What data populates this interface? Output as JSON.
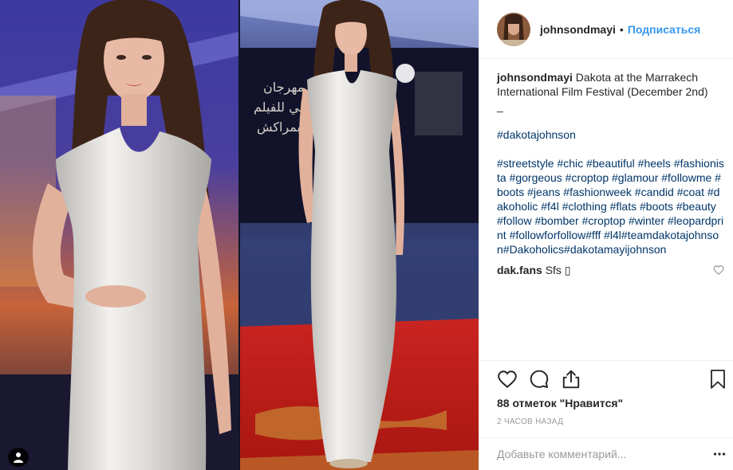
{
  "post": {
    "username": "johnsondmayi",
    "header_separator": "•",
    "follow_label": "Подписаться",
    "caption": {
      "username": "johnsondmayi",
      "text": "Dakota at the Marrakech International Film Festival (December 2nd)",
      "dash": "_",
      "tag_line": "#dakotajohnson",
      "hashtags": "#streetstyle #chic #beautiful #heels #fashionista #gorgeous #croptop #glamour #followme #boots #jeans #fashionweek #candid #coat #dakoholic #f4l #clothing #flats #boots #beauty #follow #bomber #croptop #winter #leopardprint #followforfollow#fff #l4l#teamdakotajohnson#Dakoholics#dakotamayijohnson"
    },
    "comments": [
      {
        "username": "dak.fans",
        "text": "Sfs ▯"
      }
    ],
    "likes": "88 отметок \"Нравится\"",
    "time": "2 часов назад",
    "add_comment_placeholder": "Добавьте комментарий..."
  },
  "icons": {
    "heart": "heart-icon",
    "comment": "comment-icon",
    "share": "share-icon",
    "bookmark": "bookmark-icon",
    "more": "more-icon",
    "user_tag": "user-tag-icon"
  },
  "colors": {
    "link_blue": "#3897f0",
    "hashtag_blue": "#003569",
    "text": "#262626",
    "muted": "#999999",
    "border": "#efefef",
    "carpet_red": "#c8201e",
    "dress_silver": "#e8e6e3"
  }
}
